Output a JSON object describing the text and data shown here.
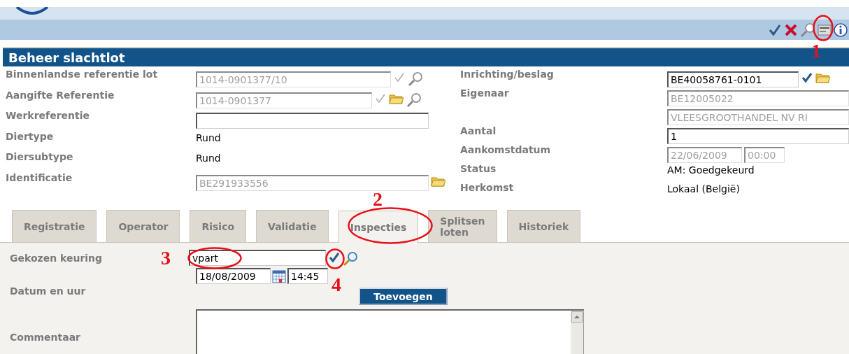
{
  "toolbar": [
    {
      "kind": "check"
    },
    {
      "kind": "close"
    },
    {
      "kind": "search"
    },
    {
      "kind": "card"
    },
    {
      "kind": "info"
    }
  ],
  "title": "Beheer slachtlot",
  "left_fields": [
    {
      "label": "Binnenlandse referentie lot",
      "kind": "input",
      "value": "1014-0901377/10",
      "disabled": true,
      "icons": [
        {
          "kind": "check",
          "disabled": true
        },
        {
          "kind": "search"
        }
      ]
    },
    {
      "label": "Aangifte Referentie",
      "kind": "input",
      "value": "1014-0901377",
      "disabled": true,
      "icons": [
        {
          "kind": "check",
          "disabled": true
        },
        {
          "kind": "folder"
        },
        {
          "kind": "search"
        }
      ]
    },
    {
      "label": "Werkreferentie",
      "kind": "input",
      "disabled": false
    },
    {
      "label": "Diertype",
      "kind": "text",
      "value": "Rund"
    },
    {
      "label": "Diersubtype",
      "kind": "text",
      "value": "Rund"
    },
    {
      "label": "Identificatie",
      "kind": "input",
      "value": "BE291933556",
      "disabled": true,
      "icons": [
        {
          "kind": "folder"
        }
      ]
    }
  ],
  "right_fields": [
    {
      "label": "Inrichting/beslag",
      "kind": "input",
      "value": "BE40058761-0101",
      "disabled": false,
      "icons": [
        {
          "kind": "check",
          "disabled": false
        },
        {
          "kind": "folder"
        }
      ]
    },
    {
      "label": "Eigenaar",
      "kind": "input",
      "value": "BE12005022",
      "disabled": true
    },
    {
      "kind": "input",
      "value": "VLEESGROOTHANDEL NV RI",
      "disabled": true
    },
    {
      "label": "Aantal",
      "kind": "input",
      "value": "1",
      "disabled": false
    },
    {
      "label": "Aankomstdatum",
      "kind": "datetime",
      "date": "22/06/2009",
      "time": "00:00",
      "disabled": true
    },
    {
      "label": "Status",
      "kind": "text",
      "value": "AM: Goedgekeurd"
    },
    {
      "label": "Herkomst",
      "kind": "text",
      "value": "Lokaal (België)"
    }
  ],
  "tabs": [
    {
      "label": "Registratie",
      "selected": false
    },
    {
      "label": "Operator",
      "selected": false
    },
    {
      "label": "Risico",
      "selected": false
    },
    {
      "label": "Validatie",
      "selected": false
    },
    {
      "label": "Inspecties",
      "selected": true
    },
    {
      "label": "Splitsen loten",
      "selected": false
    },
    {
      "label": "Historiek",
      "selected": false
    }
  ],
  "inspection": {
    "keuring_label": "Gekozen keuring",
    "keuring_value": "vpart",
    "datum_label": "Datum en uur",
    "date": "18/08/2009",
    "time": "14:45",
    "button": "Toevoegen",
    "comment_label": "Commentaar"
  },
  "annotations": [
    "1",
    "2",
    "3",
    "4"
  ]
}
